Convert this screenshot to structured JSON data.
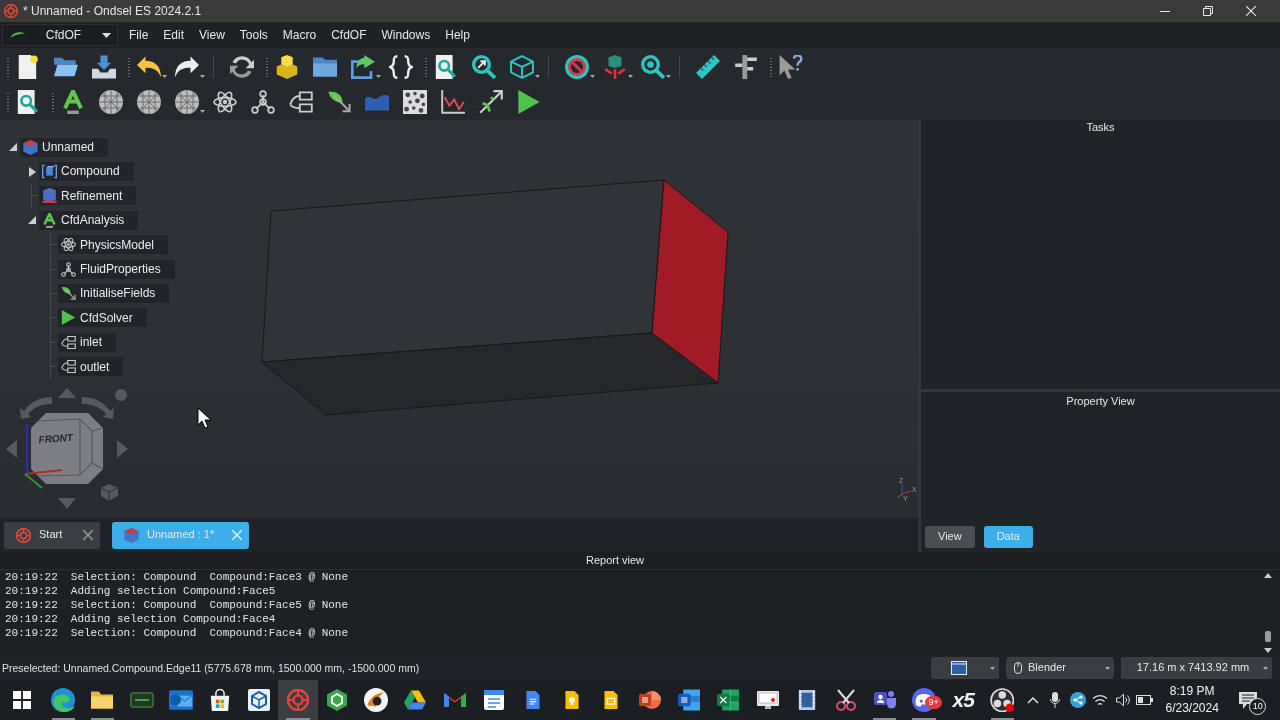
{
  "window": {
    "title": "* Unnamed - Ondsel ES 2024.2.1"
  },
  "workbench": {
    "label": "CfdOF"
  },
  "menu": [
    "File",
    "Edit",
    "View",
    "Tools",
    "Macro",
    "CfdOF",
    "Windows",
    "Help"
  ],
  "tree": [
    {
      "label": "Unnamed",
      "kind": "document",
      "expanded": true,
      "children": [
        {
          "label": "Compound",
          "kind": "compound",
          "expanded": false
        },
        {
          "label": "Refinement",
          "kind": "refinement"
        },
        {
          "label": "CfdAnalysis",
          "kind": "analysis",
          "expanded": true,
          "children": [
            {
              "label": "PhysicsModel",
              "kind": "physics"
            },
            {
              "label": "FluidProperties",
              "kind": "fluid"
            },
            {
              "label": "InitialiseFields",
              "kind": "initialise"
            },
            {
              "label": "CfdSolver",
              "kind": "solver"
            },
            {
              "label": "inlet",
              "kind": "boundary"
            },
            {
              "label": "outlet",
              "kind": "boundary"
            }
          ]
        }
      ]
    }
  ],
  "navigation_cube": {
    "face_label": "FRONT"
  },
  "axis_labels": [
    "Z",
    "X",
    "Y"
  ],
  "document_tabs": [
    {
      "label": "Start",
      "kind": "start",
      "selected": false
    },
    {
      "label": "Unnamed : 1*",
      "kind": "document",
      "selected": true
    }
  ],
  "tasks_panel": {
    "title": "Tasks"
  },
  "property_view": {
    "title": "Property View",
    "tabs": [
      {
        "label": "View",
        "selected": false
      },
      {
        "label": "Data",
        "selected": true
      }
    ]
  },
  "report_view": {
    "title": "Report view",
    "lines": [
      {
        "time": "20:19:22",
        "message": "Selection: Compound  Compound:Face3 @ None"
      },
      {
        "time": "20:19:22",
        "message": "Adding selection Compound:Face5"
      },
      {
        "time": "20:19:22",
        "message": "Selection: Compound  Compound:Face5 @ None"
      },
      {
        "time": "20:19:22",
        "message": "Adding selection Compound:Face4"
      },
      {
        "time": "20:19:22",
        "message": "Selection: Compound  Compound:Face4 @ None"
      }
    ]
  },
  "status_bar": {
    "message": "Preselected: Unnamed.Compound.Edge11 (5775.678 mm, 1500.000 mm, -1500.000 mm)",
    "navigation_style": "Blender",
    "dimensions": "17.16 m x 7413.92 mm"
  },
  "taskbar": {
    "apps": [
      {
        "kind": "start",
        "running": false,
        "selected": false
      },
      {
        "kind": "swirl",
        "running": true,
        "selected": false
      },
      {
        "kind": "folder",
        "running": true,
        "selected": false
      },
      {
        "kind": "frame",
        "running": false,
        "selected": false
      },
      {
        "kind": "mailtile",
        "running": false,
        "selected": false
      },
      {
        "kind": "bag",
        "running": false,
        "selected": false
      },
      {
        "kind": "boxtile",
        "running": false,
        "selected": false
      },
      {
        "kind": "target",
        "running": true,
        "selected": true
      },
      {
        "kind": "hexagon",
        "running": false,
        "selected": false
      },
      {
        "kind": "splitcircle",
        "running": false,
        "selected": false
      },
      {
        "kind": "triangle",
        "running": false,
        "selected": false
      },
      {
        "kind": "envelope",
        "running": false,
        "selected": false
      },
      {
        "kind": "calendar",
        "running": false,
        "selected": false
      },
      {
        "kind": "document",
        "running": false,
        "selected": false
      },
      {
        "kind": "bulb",
        "running": false,
        "selected": false
      },
      {
        "kind": "slides",
        "running": false,
        "selected": false
      },
      {
        "kind": "presentation",
        "running": false,
        "selected": false
      },
      {
        "kind": "texttile",
        "running": false,
        "selected": false
      },
      {
        "kind": "sheet",
        "running": false,
        "selected": false
      },
      {
        "kind": "recorder",
        "running": false,
        "selected": false
      },
      {
        "kind": "film",
        "running": false,
        "selected": false
      },
      {
        "kind": "scissors",
        "running": false,
        "selected": false
      },
      {
        "kind": "people",
        "running": true,
        "selected": false
      },
      {
        "kind": "gamepad",
        "running": true,
        "selected": false,
        "badge": "9+"
      },
      {
        "kind": "logo",
        "label": "x5",
        "running": false,
        "selected": false
      },
      {
        "kind": "lens",
        "running": true,
        "selected": false
      }
    ],
    "time": "8:19 PM",
    "date": "6/23/2024",
    "notifications": "10"
  }
}
